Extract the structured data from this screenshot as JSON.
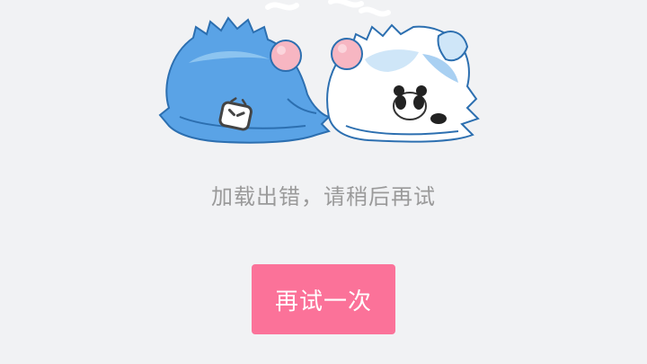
{
  "error": {
    "message": "加载出错，请稍后再试"
  },
  "retry_button": {
    "label": "再试一次"
  },
  "illustration": {
    "icon": "sleeping-mascots-illustration"
  },
  "colors": {
    "background": "#f1f2f4",
    "accent": "#fb7299",
    "message_text": "#9a9a9a",
    "mascot_blue": "#5aa3e6",
    "mascot_light": "#cfe6f8",
    "pompom_pink": "#f7b6c2"
  }
}
